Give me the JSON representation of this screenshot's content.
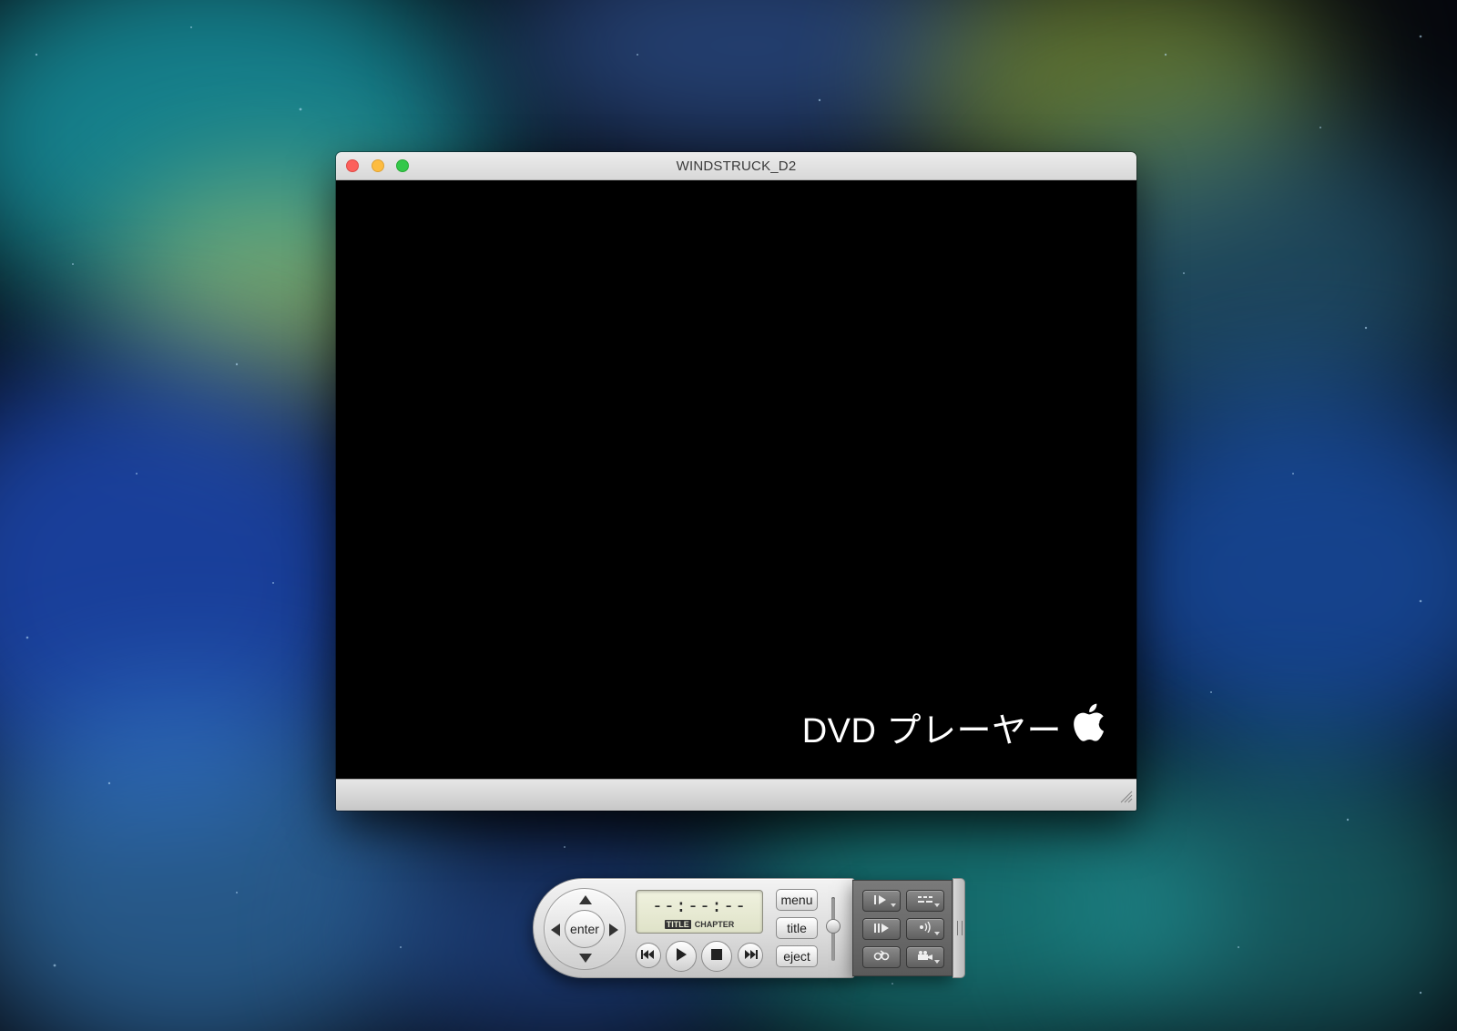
{
  "window": {
    "title": "WINDSTRUCK_D2",
    "brand_text": "DVD プレーヤー"
  },
  "controller": {
    "enter_label": "enter",
    "time_display": "--:--:--",
    "lcd_title_label": "TITLE",
    "lcd_chapter_label": "CHAPTER",
    "menu_label": "menu",
    "title_label": "title",
    "eject_label": "eject"
  },
  "colors": {
    "close": "#fc605c",
    "minimize": "#fdbc40",
    "zoom": "#34c84a",
    "video_background": "#000000"
  },
  "icons": [
    "apple-logo-icon",
    "rewind-icon",
    "play-icon",
    "stop-icon",
    "fast-forward-icon",
    "slow-motion-icon",
    "subtitles-icon",
    "step-frame-icon",
    "audio-icon",
    "loop-icon",
    "camera-angle-icon",
    "resize-grip-icon"
  ]
}
